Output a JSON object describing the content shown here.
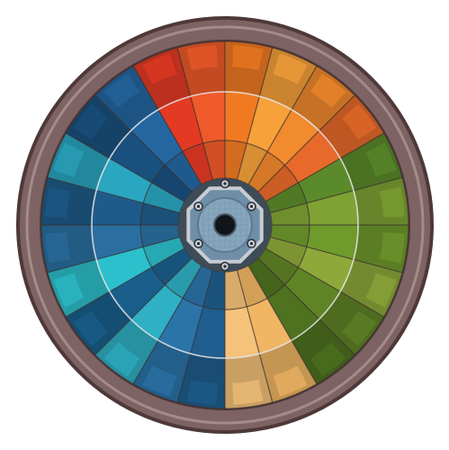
{
  "wheel": {
    "sectors": 24,
    "rings": 3,
    "palette": {
      "rim": "#7d6363",
      "rim_dark": "#4e3838",
      "rim_light": "#a58a8a",
      "divider": "#3a3030",
      "hub_plate": "#6f8fa8",
      "hub_ring": "#c8ccd2",
      "hub_bolt": "#2a2f38",
      "axle": "#111418"
    },
    "segments": [
      {
        "color": "#e43a24"
      },
      {
        "color": "#ef5a2a"
      },
      {
        "color": "#f07a22"
      },
      {
        "color": "#f6a13a"
      },
      {
        "color": "#f28a2e"
      },
      {
        "color": "#e86a2a"
      },
      {
        "color": "#5b8a2a"
      },
      {
        "color": "#7ea233"
      },
      {
        "color": "#6f9a2c"
      },
      {
        "color": "#8fa83a"
      },
      {
        "color": "#5f8426"
      },
      {
        "color": "#4e7220"
      },
      {
        "color": "#f0b664"
      },
      {
        "color": "#f5c27a"
      },
      {
        "color": "#1f5e8e"
      },
      {
        "color": "#2a74a8"
      },
      {
        "color": "#2fb0c4"
      },
      {
        "color": "#1a5f8c"
      },
      {
        "color": "#2cc0cc"
      },
      {
        "color": "#2a6fa0"
      },
      {
        "color": "#1f5b8a"
      },
      {
        "color": "#2aa6c0"
      },
      {
        "color": "#19507e"
      },
      {
        "color": "#2466a0"
      }
    ]
  }
}
